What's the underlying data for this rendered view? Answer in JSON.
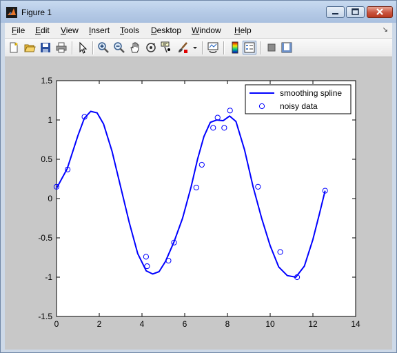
{
  "window": {
    "title": "Figure 1"
  },
  "menus": [
    {
      "first": "F",
      "rest": "ile"
    },
    {
      "first": "E",
      "rest": "dit"
    },
    {
      "first": "V",
      "rest": "iew"
    },
    {
      "first": "I",
      "rest": "nsert"
    },
    {
      "first": "T",
      "rest": "ools"
    },
    {
      "first": "D",
      "rest": "esktop"
    },
    {
      "first": "W",
      "rest": "indow"
    },
    {
      "first": "H",
      "rest": "elp"
    }
  ],
  "toolbar": {
    "icons": [
      "new-figure-icon",
      "open-file-icon",
      "save-icon",
      "print-icon",
      "edit-plot-arrow-icon",
      "zoom-in-icon",
      "zoom-out-icon",
      "pan-hand-icon",
      "rotate-3d-icon",
      "data-cursor-icon",
      "brush-icon",
      "brush-dropdown-icon",
      "link-plot-icon",
      "insert-colorbar-icon",
      "insert-legend-icon",
      "hide-plot-tools-icon",
      "show-plot-tools-icon"
    ]
  },
  "chart_data": {
    "type": "line",
    "title": "",
    "xlabel": "",
    "ylabel": "",
    "xlim": [
      0,
      14
    ],
    "ylim": [
      -1.5,
      1.5
    ],
    "xticks": [
      "0",
      "2",
      "4",
      "6",
      "8",
      "10",
      "12",
      "14"
    ],
    "yticks": [
      "1.5",
      "1",
      "0.5",
      "0",
      "-0.5",
      "-1",
      "-1.5"
    ],
    "legend_position": "top-right",
    "series": [
      {
        "name": "smoothing spline",
        "style": "line",
        "color": "#0000ff",
        "x": [
          0,
          0.5,
          1.0,
          1.3,
          1.6,
          1.9,
          2.2,
          2.6,
          3.0,
          3.4,
          3.8,
          4.2,
          4.5,
          4.8,
          5.1,
          5.5,
          5.9,
          6.3,
          6.6,
          6.9,
          7.2,
          7.5,
          7.8,
          8.1,
          8.4,
          8.8,
          9.2,
          9.6,
          10.0,
          10.4,
          10.8,
          11.2,
          11.6,
          12.0,
          12.3,
          12.57
        ],
        "y": [
          0.13,
          0.38,
          0.8,
          1.02,
          1.11,
          1.09,
          0.95,
          0.6,
          0.15,
          -0.3,
          -0.7,
          -0.92,
          -0.96,
          -0.93,
          -0.8,
          -0.55,
          -0.25,
          0.15,
          0.5,
          0.79,
          0.97,
          1.0,
          0.99,
          1.05,
          0.98,
          0.62,
          0.15,
          -0.25,
          -0.6,
          -0.87,
          -0.98,
          -1.0,
          -0.86,
          -0.52,
          -0.2,
          0.1
        ]
      },
      {
        "name": "noisy data",
        "style": "marker",
        "color": "#0000ff",
        "x": [
          0,
          0.52,
          1.31,
          4.19,
          4.24,
          5.24,
          5.5,
          6.54,
          6.8,
          7.33,
          7.54,
          7.85,
          8.12,
          9.43,
          10.47,
          11.26,
          12.57
        ],
        "y": [
          0.15,
          0.37,
          1.04,
          -0.74,
          -0.86,
          -0.79,
          -0.56,
          0.14,
          0.43,
          0.9,
          1.03,
          0.9,
          1.12,
          0.15,
          -0.68,
          -1.0,
          0.1
        ]
      }
    ]
  }
}
